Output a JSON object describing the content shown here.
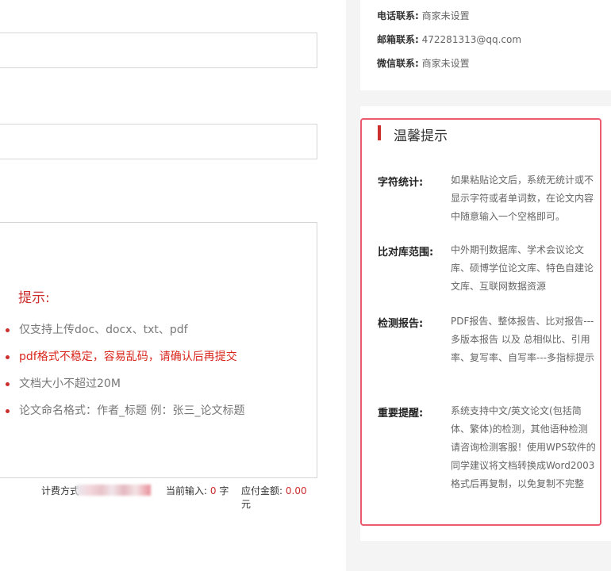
{
  "upload": {
    "tip_title": "提示:",
    "tips": [
      "仅支持上传doc、docx、txt、pdf",
      "pdf格式不稳定，容易乱码，请确认后再提交",
      "文档大小不超过20M",
      "论文命名格式：作者_标题 例：张三_论文标题"
    ]
  },
  "billing": {
    "method_label": "计费方式",
    "current_label": "当前输入:",
    "current_value": "0",
    "current_unit": "字",
    "amount_label": "应付金额:",
    "amount_value": "0.00",
    "amount_unit": "元"
  },
  "contact": {
    "phone_label": "电话联系:",
    "phone_value": "商家未设置",
    "email_label": "邮箱联系:",
    "email_value": "472281313@qq.com",
    "wechat_label": "微信联系:",
    "wechat_value": "商家未设置"
  },
  "notice": {
    "title": "温馨提示",
    "items": [
      {
        "label": "字符统计:",
        "text": "如果粘贴论文后，系统无统计或不显示字符或者单词数，在论文内容中随意输入一个空格即可。"
      },
      {
        "label": "比对库范围:",
        "text": "中外期刊数据库、学术会议论文库、硕博学位论文库、特色自建论文库、互联网数据资源"
      },
      {
        "label": "检测报告:",
        "text": "PDF报告、整体报告、比对报告---多版本报告 以及 总相似比、引用率、复写率、自写率---多指标提示"
      },
      {
        "label": "重要提醒:",
        "text": "系统支持中文/英文论文(包括简体、繁体)的检测，其他语种检测请咨询检测客服！使用WPS软件的同学建议将文档转换成Word2003格式后再复制，以免复制不完整"
      }
    ]
  },
  "colors": {
    "accent_red": "#cc2d2d",
    "notice_border": "#ec5a6f",
    "sidebar_bg": "#f4f4f4"
  }
}
